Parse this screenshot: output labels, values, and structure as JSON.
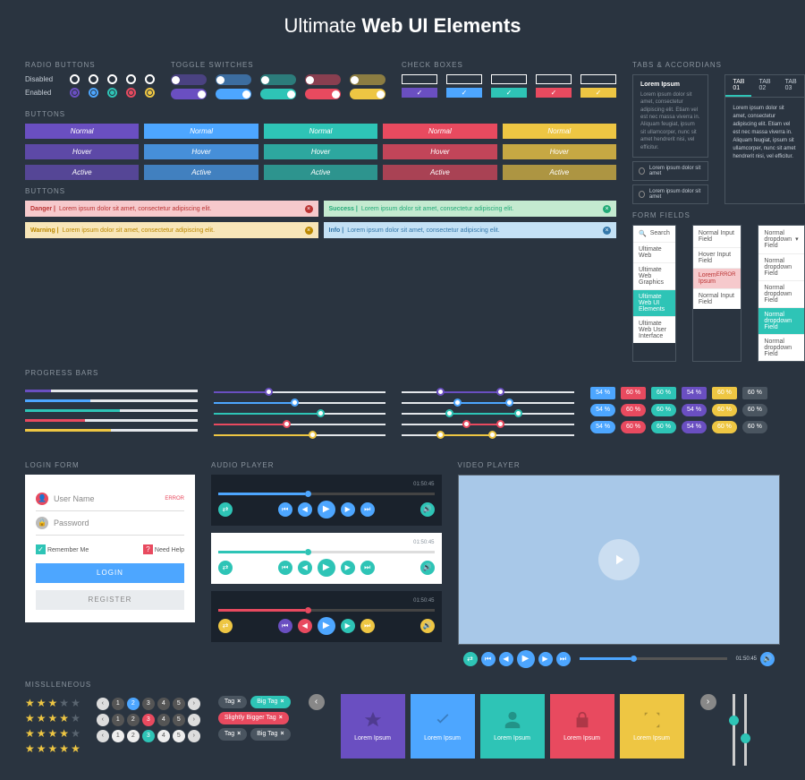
{
  "title_pre": "Ultimate ",
  "title_bold": "Web UI Elements",
  "sections": {
    "radio": "RADIO BUTTONS",
    "toggle": "TOGGLE SWITCHES",
    "check": "CHECK BOXES",
    "tabs": "TABS & ACCORDIANS",
    "buttons": "BUTTONS",
    "buttons2": "BUTTONS",
    "progress": "PROGRESS BARS",
    "login": "LOGIN FORM",
    "audio": "AUDIO PLAYER",
    "video": "VIDEO PLAYER",
    "misc": "MISSLLENEOUS",
    "form": "FORM FIELDS"
  },
  "radio": {
    "disabled": "Disabled",
    "enabled": "Enabled"
  },
  "colors": [
    "#6a4fc1",
    "#4da6ff",
    "#2ec4b6",
    "#e84a5f",
    "#eec643"
  ],
  "btn_states": [
    "Normal",
    "Hover",
    "Active"
  ],
  "alerts": [
    {
      "k": "Danger",
      "c": "#f6c9cc",
      "t": "#b33",
      "msg": "Lorem ipsum dolor sit amet, consectetur adipiscing elit."
    },
    {
      "k": "Success",
      "c": "#c4ead0",
      "t": "#2a7",
      "msg": "Lorem ipsum dolor sit amet, consectetur adipiscing elit."
    },
    {
      "k": "Warning",
      "c": "#f8e6b8",
      "t": "#b80",
      "msg": "Lorem ipsum dolor sit amet, consectetur adipiscing elit."
    },
    {
      "k": "Info",
      "c": "#c4e1f5",
      "t": "#37a",
      "msg": "Lorem ipsum dolor sit amet, consectetur adipiscing elit."
    }
  ],
  "progress": [
    15,
    38,
    55,
    35,
    50
  ],
  "sliders": [
    30,
    45,
    60,
    40,
    55
  ],
  "range": [
    [
      20,
      55
    ],
    [
      30,
      60
    ],
    [
      25,
      65
    ],
    [
      35,
      55
    ],
    [
      20,
      50
    ]
  ],
  "tooltips": [
    [
      "54 %",
      "60 %",
      "60 %",
      "54 %",
      "60 %",
      "60 %"
    ],
    [
      "54 %",
      "60 %",
      "60 %",
      "54 %",
      "60 %",
      "60 %"
    ],
    [
      "54 %",
      "60 %",
      "60 %",
      "54 %",
      "60 %",
      "60 %"
    ]
  ],
  "tabs": [
    "TAB 01",
    "TAB 02",
    "TAB 03"
  ],
  "lorem": "Lorem ipsum dolor sit amet, consectetur adipiscing elit. Etiam vel est nec massa viverra in. Aliquam feugiat, ipsum sit ullamcorper, nunc sit amet hendrerit nisi, vel efficitur.",
  "acc_items": [
    "Lorem ipsum dolor sit amet",
    "Lorem ipsum dolor sit amet"
  ],
  "form": {
    "search": "Search",
    "input": "Normal Input Field",
    "dropdown": "Normal dropdown Field",
    "search_opts": [
      "Ultimate Web",
      "Ultimate Web Graphics",
      "Ultimate Web UI Elements",
      "Ultimate Web User Interface"
    ],
    "input_opts": [
      "Hover Input Field",
      "Lorem Ipsum",
      "Normal Input Field"
    ],
    "input_err": "ERROR",
    "dd_opts": [
      "Normal dropdown Field",
      "Normal dropdown Field",
      "Normal dropdown Field",
      "Normal dropdown Field"
    ]
  },
  "login": {
    "user": "User Name",
    "pass": "Password",
    "err": "ERROR",
    "remember": "Remember Me",
    "help": "Need Help",
    "login": "LOGIN",
    "register": "REGISTER"
  },
  "player": {
    "t1": "01:50:45",
    "t2": "01:50:45"
  },
  "stars": [
    [
      3,
      2
    ],
    [
      4,
      1
    ],
    [
      4,
      1
    ],
    [
      5,
      0
    ]
  ],
  "pagers": [
    {
      "style": "circle",
      "bg": "#555",
      "items": [
        "1",
        "2",
        "3",
        "4",
        "5"
      ],
      "active": 1,
      "ac": "#4da6ff"
    },
    {
      "style": "circle",
      "bg": "#555",
      "items": [
        "1",
        "2",
        "3",
        "4",
        "5"
      ],
      "active": 2,
      "ac": "#e84a5f"
    },
    {
      "style": "circle",
      "bg": "#eee",
      "items": [
        "1",
        "2",
        "3",
        "4",
        "5"
      ],
      "active": 2,
      "ac": "#2ec4b6",
      "dark": true
    }
  ],
  "tags": [
    [
      {
        "t": "Tag",
        "c": "#4a5560"
      },
      {
        "t": "Big Tag",
        "c": "#2ec4b6"
      }
    ],
    [
      {
        "t": "Slightly Bigger Tag",
        "c": "#e84a5f"
      }
    ],
    [
      {
        "t": "Tag",
        "c": "#4a5560"
      },
      {
        "t": "Big Tag",
        "c": "#4a5560"
      }
    ]
  ],
  "tiles": [
    {
      "c": "#6a4fc1",
      "t": "Lorem Ipsum",
      "i": "star"
    },
    {
      "c": "#4da6ff",
      "t": "Lorem Ipsum",
      "i": "check"
    },
    {
      "c": "#2ec4b6",
      "t": "Lorem Ipsum",
      "i": "user"
    },
    {
      "c": "#e84a5f",
      "t": "Lorem Ipsum",
      "i": "lock"
    },
    {
      "c": "#eec643",
      "t": "Lorem Ipsum",
      "i": "shuffle"
    }
  ]
}
